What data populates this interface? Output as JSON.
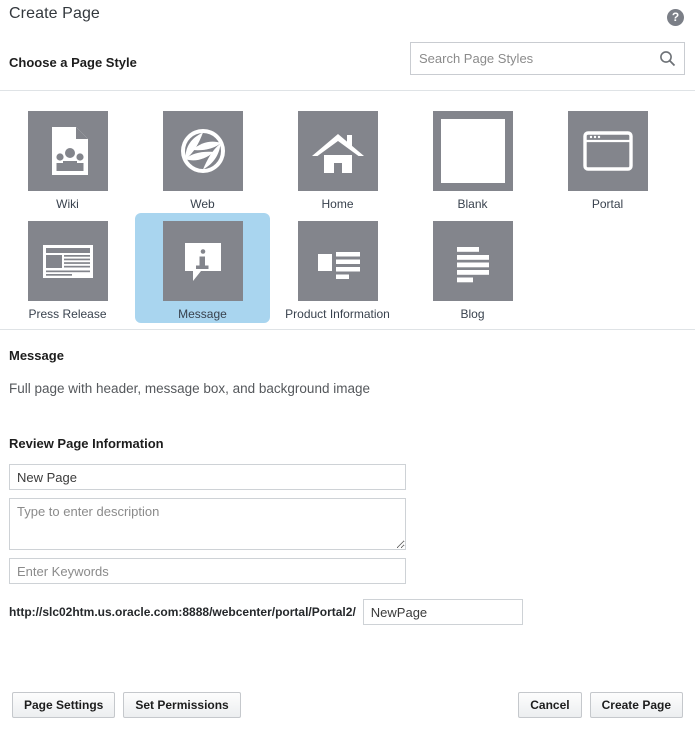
{
  "header": {
    "title": "Create Page",
    "help_icon": "help-circle-icon",
    "help_label": "?"
  },
  "style_section": {
    "label": "Choose a Page Style",
    "search": {
      "placeholder": "Search Page Styles",
      "value": "",
      "icon": "search-icon"
    }
  },
  "page_styles": {
    "selected": "Message",
    "rows": [
      [
        {
          "label": "Wiki",
          "icon": "wiki-document-people-icon",
          "selected": false
        },
        {
          "label": "Web",
          "icon": "globe-icon",
          "selected": false
        },
        {
          "label": "Home",
          "icon": "house-icon",
          "selected": false
        },
        {
          "label": "Blank",
          "icon": "blank-page-icon",
          "selected": false
        },
        {
          "label": "Portal",
          "icon": "browser-window-icon",
          "selected": false
        }
      ],
      [
        {
          "label": "Press Release",
          "icon": "newspaper-icon",
          "selected": false
        },
        {
          "label": "Message",
          "icon": "info-speech-bubble-icon",
          "selected": true
        },
        {
          "label": "Product Information",
          "icon": "image-with-text-lines-icon",
          "selected": false
        },
        {
          "label": "Blog",
          "icon": "text-lines-icon",
          "selected": false
        }
      ]
    ]
  },
  "description": {
    "title": "Message",
    "text": "Full page with header, message box, and background image"
  },
  "review": {
    "title": "Review Page Information",
    "name_field": {
      "value": "New Page",
      "placeholder": ""
    },
    "description_field": {
      "value": "",
      "placeholder": "Type to enter description"
    },
    "keywords_field": {
      "value": "",
      "placeholder": "Enter Keywords"
    },
    "url": {
      "prefix": "http://slc02htm.us.oracle.com:8888/webcenter/portal/Portal2/",
      "value": "NewPage"
    }
  },
  "footer": {
    "page_settings": "Page Settings",
    "set_permissions": "Set Permissions",
    "cancel": "Cancel",
    "create_page": "Create Page"
  },
  "colors": {
    "thumb_gray": "#83858c",
    "selection_blue": "#a9d5ef",
    "label_text": "#39424e",
    "divider": "#dfe3e6"
  }
}
